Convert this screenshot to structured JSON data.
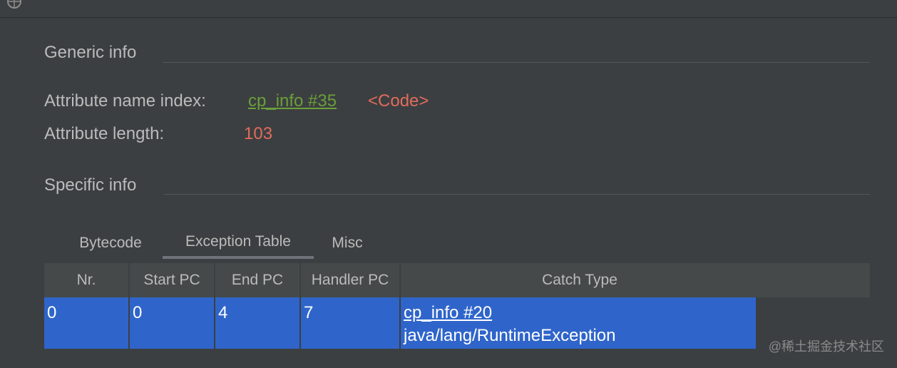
{
  "generic": {
    "title": "Generic info",
    "attr_name_label": "Attribute name index:",
    "attr_name_link": "cp_info #35",
    "attr_name_value": "<Code>",
    "attr_length_label": "Attribute length:",
    "attr_length_value": "103"
  },
  "specific": {
    "title": "Specific info",
    "tabs": [
      {
        "label": "Bytecode",
        "active": false
      },
      {
        "label": "Exception Table",
        "active": true
      },
      {
        "label": "Misc",
        "active": false
      }
    ],
    "table": {
      "columns": [
        "Nr.",
        "Start PC",
        "End PC",
        "Handler PC",
        "Catch Type"
      ],
      "rows": [
        {
          "nr": "0",
          "start_pc": "0",
          "end_pc": "4",
          "handler_pc": "7",
          "catch_type_link": "cp_info #20",
          "catch_type_name": "java/lang/RuntimeException"
        }
      ]
    }
  },
  "watermark": "@稀土掘金技术社区",
  "colors": {
    "background": "#3c3f41",
    "link_green": "#6a9f3a",
    "value_red": "#e06c5c",
    "selection_blue": "#2f65ca"
  }
}
